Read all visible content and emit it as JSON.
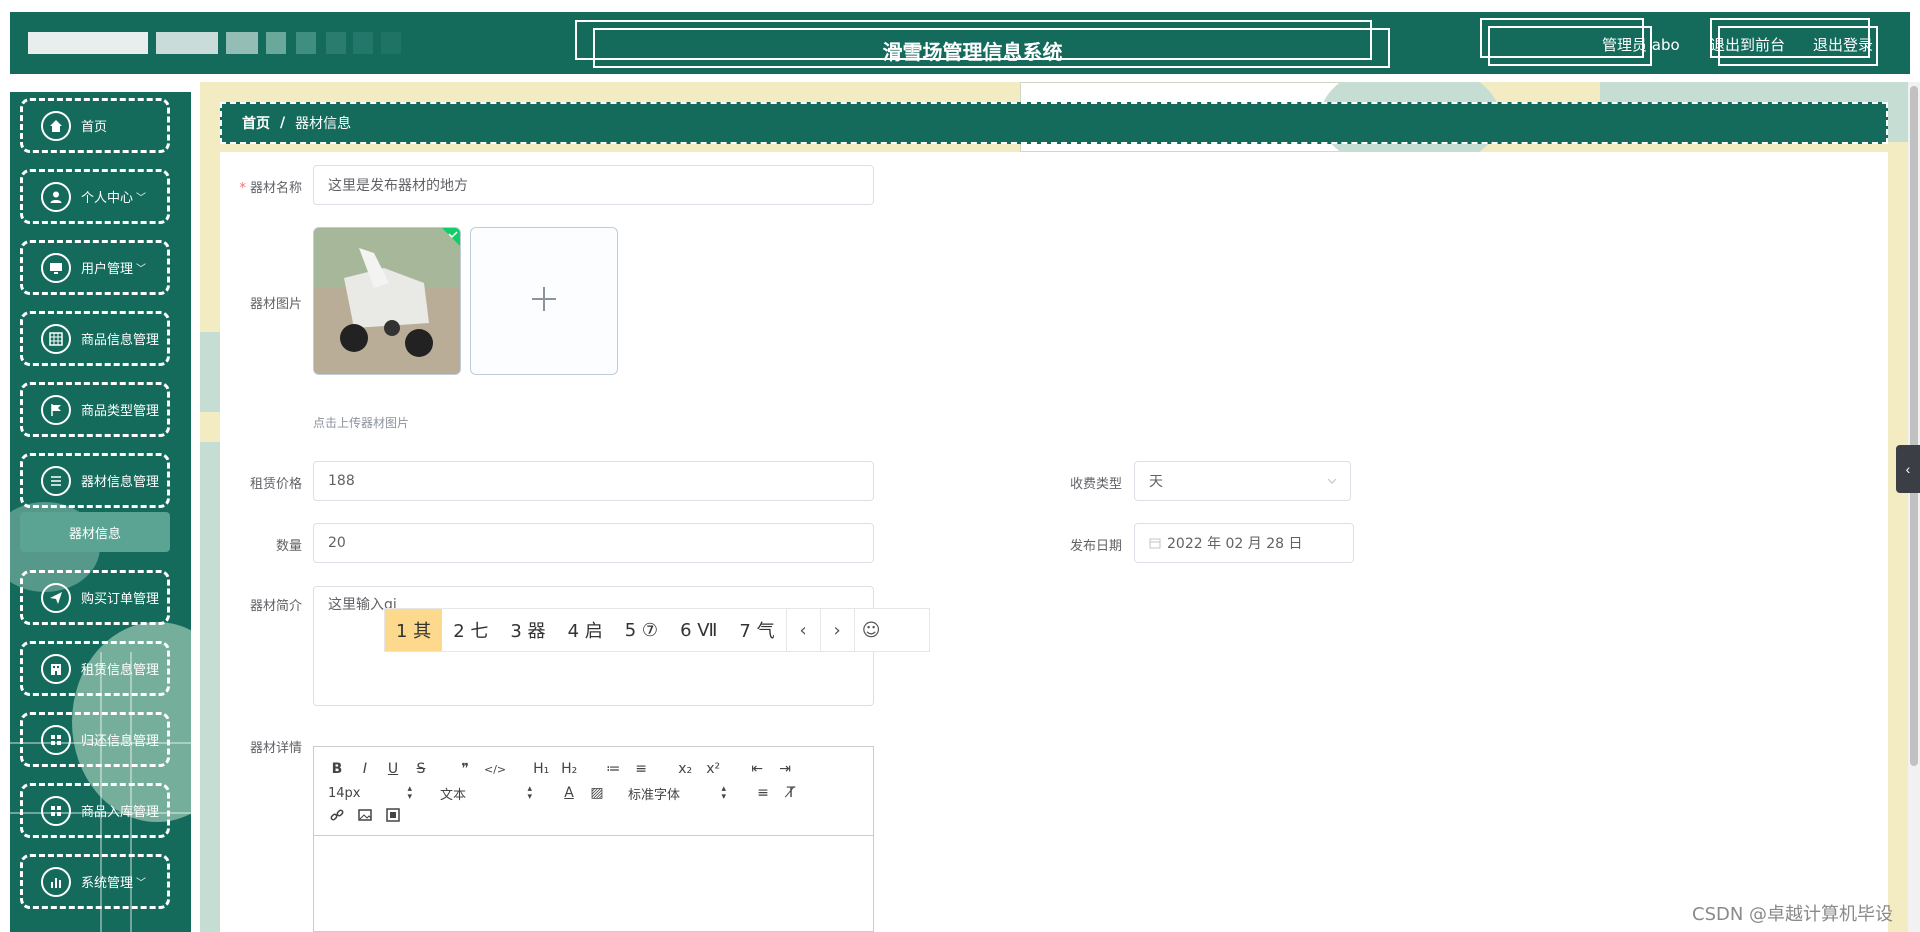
{
  "header": {
    "title": "滑雪场管理信息系统",
    "user_label": "管理员 abo",
    "to_front_label": "退出到前台",
    "logout_label": "退出登录"
  },
  "sidebar": {
    "items": [
      {
        "label": "首页",
        "icon": "home-icon",
        "has_children": false
      },
      {
        "label": "个人中心",
        "icon": "user-icon",
        "has_children": true
      },
      {
        "label": "用户管理",
        "icon": "monitor-icon",
        "has_children": true
      },
      {
        "label": "商品信息管理",
        "icon": "grid-icon",
        "has_children": false
      },
      {
        "label": "商品类型管理",
        "icon": "flag-icon",
        "has_children": false
      },
      {
        "label": "器材信息管理",
        "icon": "list-icon",
        "has_children": false
      },
      {
        "label": "购买订单管理",
        "icon": "send-icon",
        "has_children": false
      },
      {
        "label": "租赁信息管理",
        "icon": "building-icon",
        "has_children": false
      },
      {
        "label": "归还信息管理",
        "icon": "grid-icon",
        "has_children": false
      },
      {
        "label": "商品入库管理",
        "icon": "grid-icon",
        "has_children": false
      },
      {
        "label": "系统管理",
        "icon": "chart-icon",
        "has_children": true
      }
    ],
    "submenu_label": "器材信息"
  },
  "breadcrumb": {
    "home": "首页",
    "separator": "/",
    "current": "器材信息"
  },
  "form": {
    "name_label": "器材名称",
    "name_value": "这里是发布器材的地方",
    "image_label": "器材图片",
    "upload_tip": "点击上传器材图片",
    "price_label": "租赁价格",
    "price_value": "188",
    "charge_type_label": "收费类型",
    "charge_type_value": "天",
    "quantity_label": "数量",
    "quantity_value": "20",
    "publish_date_label": "发布日期",
    "publish_date_value": "2022 年 02 月 28 日",
    "intro_label": "器材简介",
    "intro_value": "这里输入qi",
    "detail_label": "器材详情"
  },
  "editor_toolbar": {
    "row1": [
      "B",
      "I",
      "U",
      "S",
      "❞",
      "</>",
      "H₁",
      "H₂",
      "≔",
      "≡",
      "x₂",
      "x²",
      "⇤",
      "⇥"
    ],
    "size_select": "14px",
    "text_select": "文本",
    "font_select": "标准字体"
  },
  "ime": {
    "candidates": [
      "1 其",
      "2 七",
      "3 器",
      "4 启",
      "5 ⑦",
      "6 Ⅶ",
      "7 气"
    ]
  },
  "watermark": "CSDN @卓越计算机毕设",
  "colors": {
    "primary": "#146b5c",
    "background": "#f3ecc3",
    "submenu": "#5ba493",
    "ime_highlight": "#fcd98d"
  }
}
